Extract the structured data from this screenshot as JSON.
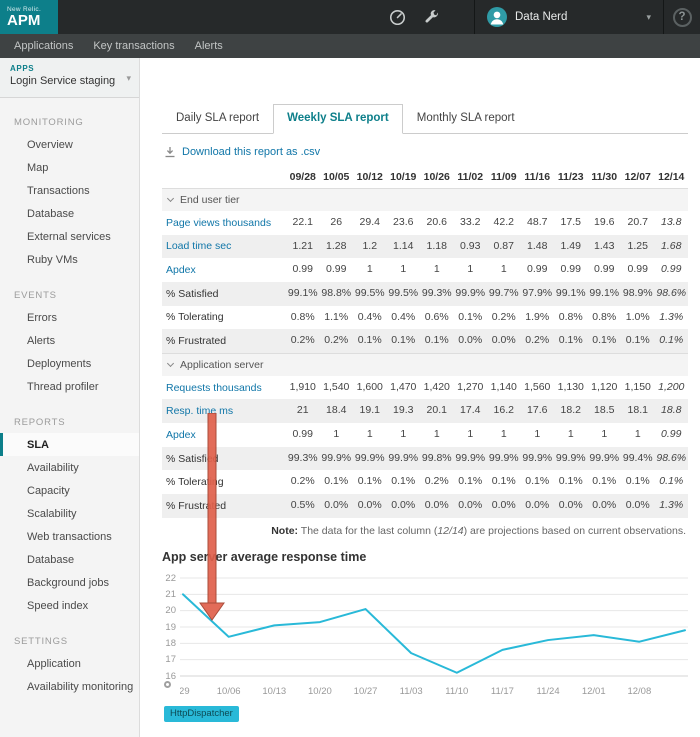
{
  "theme": {
    "brand_teal": "#0d7f8a",
    "link_blue": "#1076a8",
    "arrow_color": "#e0604b",
    "arrow_stroke": "#a33d2a"
  },
  "header": {
    "brand_small": "New Relic.",
    "brand_big": "APM",
    "user_name": "Data Nerd",
    "help_label": "?"
  },
  "nav": {
    "items": [
      "Applications",
      "Key transactions",
      "Alerts"
    ]
  },
  "app_selector": {
    "label": "APPS",
    "value": "Login Service staging"
  },
  "sidebar": {
    "active_item": "SLA",
    "sections": [
      {
        "title": "MONITORING",
        "items": [
          "Overview",
          "Map",
          "Transactions",
          "Database",
          "External services",
          "Ruby VMs"
        ]
      },
      {
        "title": "EVENTS",
        "items": [
          "Errors",
          "Alerts",
          "Deployments",
          "Thread profiler"
        ]
      },
      {
        "title": "REPORTS",
        "items": [
          "SLA",
          "Availability",
          "Capacity",
          "Scalability",
          "Web transactions",
          "Database",
          "Background jobs",
          "Speed index"
        ]
      },
      {
        "title": "SETTINGS",
        "items": [
          "Application",
          "Availability monitoring"
        ]
      }
    ]
  },
  "report": {
    "tabs": [
      {
        "label": "Daily SLA report",
        "active": false
      },
      {
        "label": "Weekly SLA report",
        "active": true
      },
      {
        "label": "Monthly SLA report",
        "active": false
      }
    ],
    "download_label": "Download this report as .csv",
    "table": {
      "columns": [
        "09/28",
        "10/05",
        "10/12",
        "10/19",
        "10/26",
        "11/02",
        "11/09",
        "11/16",
        "11/23",
        "11/30",
        "12/07",
        "12/14"
      ],
      "sections": [
        {
          "name": "End user tier",
          "rows": [
            {
              "label": "Page views thousands",
              "link": true,
              "values": [
                "22.1",
                "26",
                "29.4",
                "23.6",
                "20.6",
                "33.2",
                "42.2",
                "48.7",
                "17.5",
                "19.6",
                "20.7",
                "13.8"
              ]
            },
            {
              "label": "Load time sec",
              "link": true,
              "values": [
                "1.21",
                "1.28",
                "1.2",
                "1.14",
                "1.18",
                "0.93",
                "0.87",
                "1.48",
                "1.49",
                "1.43",
                "1.25",
                "1.68"
              ]
            },
            {
              "label": "Apdex",
              "link": true,
              "values": [
                "0.99",
                "0.99",
                "1",
                "1",
                "1",
                "1",
                "1",
                "0.99",
                "0.99",
                "0.99",
                "0.99",
                "0.99"
              ]
            },
            {
              "label": "% Satisfied",
              "link": false,
              "values": [
                "99.1%",
                "98.8%",
                "99.5%",
                "99.5%",
                "99.3%",
                "99.9%",
                "99.7%",
                "97.9%",
                "99.1%",
                "99.1%",
                "98.9%",
                "98.6%"
              ]
            },
            {
              "label": "% Tolerating",
              "link": false,
              "values": [
                "0.8%",
                "1.1%",
                "0.4%",
                "0.4%",
                "0.6%",
                "0.1%",
                "0.2%",
                "1.9%",
                "0.8%",
                "0.8%",
                "1.0%",
                "1.3%"
              ]
            },
            {
              "label": "% Frustrated",
              "link": false,
              "values": [
                "0.2%",
                "0.2%",
                "0.1%",
                "0.1%",
                "0.1%",
                "0.0%",
                "0.0%",
                "0.2%",
                "0.1%",
                "0.1%",
                "0.1%",
                "0.1%"
              ]
            }
          ]
        },
        {
          "name": "Application server",
          "rows": [
            {
              "label": "Requests thousands",
              "link": true,
              "values": [
                "1,910",
                "1,540",
                "1,600",
                "1,470",
                "1,420",
                "1,270",
                "1,140",
                "1,560",
                "1,130",
                "1,120",
                "1,150",
                "1,200"
              ]
            },
            {
              "label": "Resp. time ms",
              "link": true,
              "values": [
                "21",
                "18.4",
                "19.1",
                "19.3",
                "20.1",
                "17.4",
                "16.2",
                "17.6",
                "18.2",
                "18.5",
                "18.1",
                "18.8"
              ]
            },
            {
              "label": "Apdex",
              "link": true,
              "values": [
                "0.99",
                "1",
                "1",
                "1",
                "1",
                "1",
                "1",
                "1",
                "1",
                "1",
                "1",
                "0.99"
              ]
            },
            {
              "label": "% Satisfied",
              "link": false,
              "values": [
                "99.3%",
                "99.9%",
                "99.9%",
                "99.9%",
                "99.8%",
                "99.9%",
                "99.9%",
                "99.9%",
                "99.9%",
                "99.9%",
                "99.4%",
                "98.6%"
              ]
            },
            {
              "label": "% Tolerating",
              "link": false,
              "values": [
                "0.2%",
                "0.1%",
                "0.1%",
                "0.1%",
                "0.2%",
                "0.1%",
                "0.1%",
                "0.1%",
                "0.1%",
                "0.1%",
                "0.1%",
                "0.1%"
              ]
            },
            {
              "label": "% Frustrated",
              "link": false,
              "values": [
                "0.5%",
                "0.0%",
                "0.0%",
                "0.0%",
                "0.0%",
                "0.0%",
                "0.0%",
                "0.0%",
                "0.0%",
                "0.0%",
                "0.0%",
                "1.3%"
              ]
            }
          ]
        }
      ]
    },
    "note": {
      "bold": "Note:",
      "pre": " The data for the last column (",
      "em": "12/14",
      "post": ") are projections based on current observations."
    }
  },
  "chart_data": {
    "type": "line",
    "title": "App server average response time",
    "x_labels": [
      "/29",
      "10/06",
      "10/13",
      "10/20",
      "10/27",
      "11/03",
      "11/10",
      "11/17",
      "11/24",
      "12/01",
      "12/08"
    ],
    "y_ticks": [
      16,
      17,
      18,
      19,
      20,
      21,
      22
    ],
    "ylim": [
      16,
      22
    ],
    "grid": true,
    "legend_position": "bottom-left",
    "series": [
      {
        "name": "HttpDispatcher",
        "color": "#29b9d8",
        "values": [
          21,
          18.4,
          19.1,
          19.3,
          20.1,
          17.4,
          16.2,
          17.6,
          18.2,
          18.5,
          18.1,
          18.8
        ]
      }
    ]
  }
}
